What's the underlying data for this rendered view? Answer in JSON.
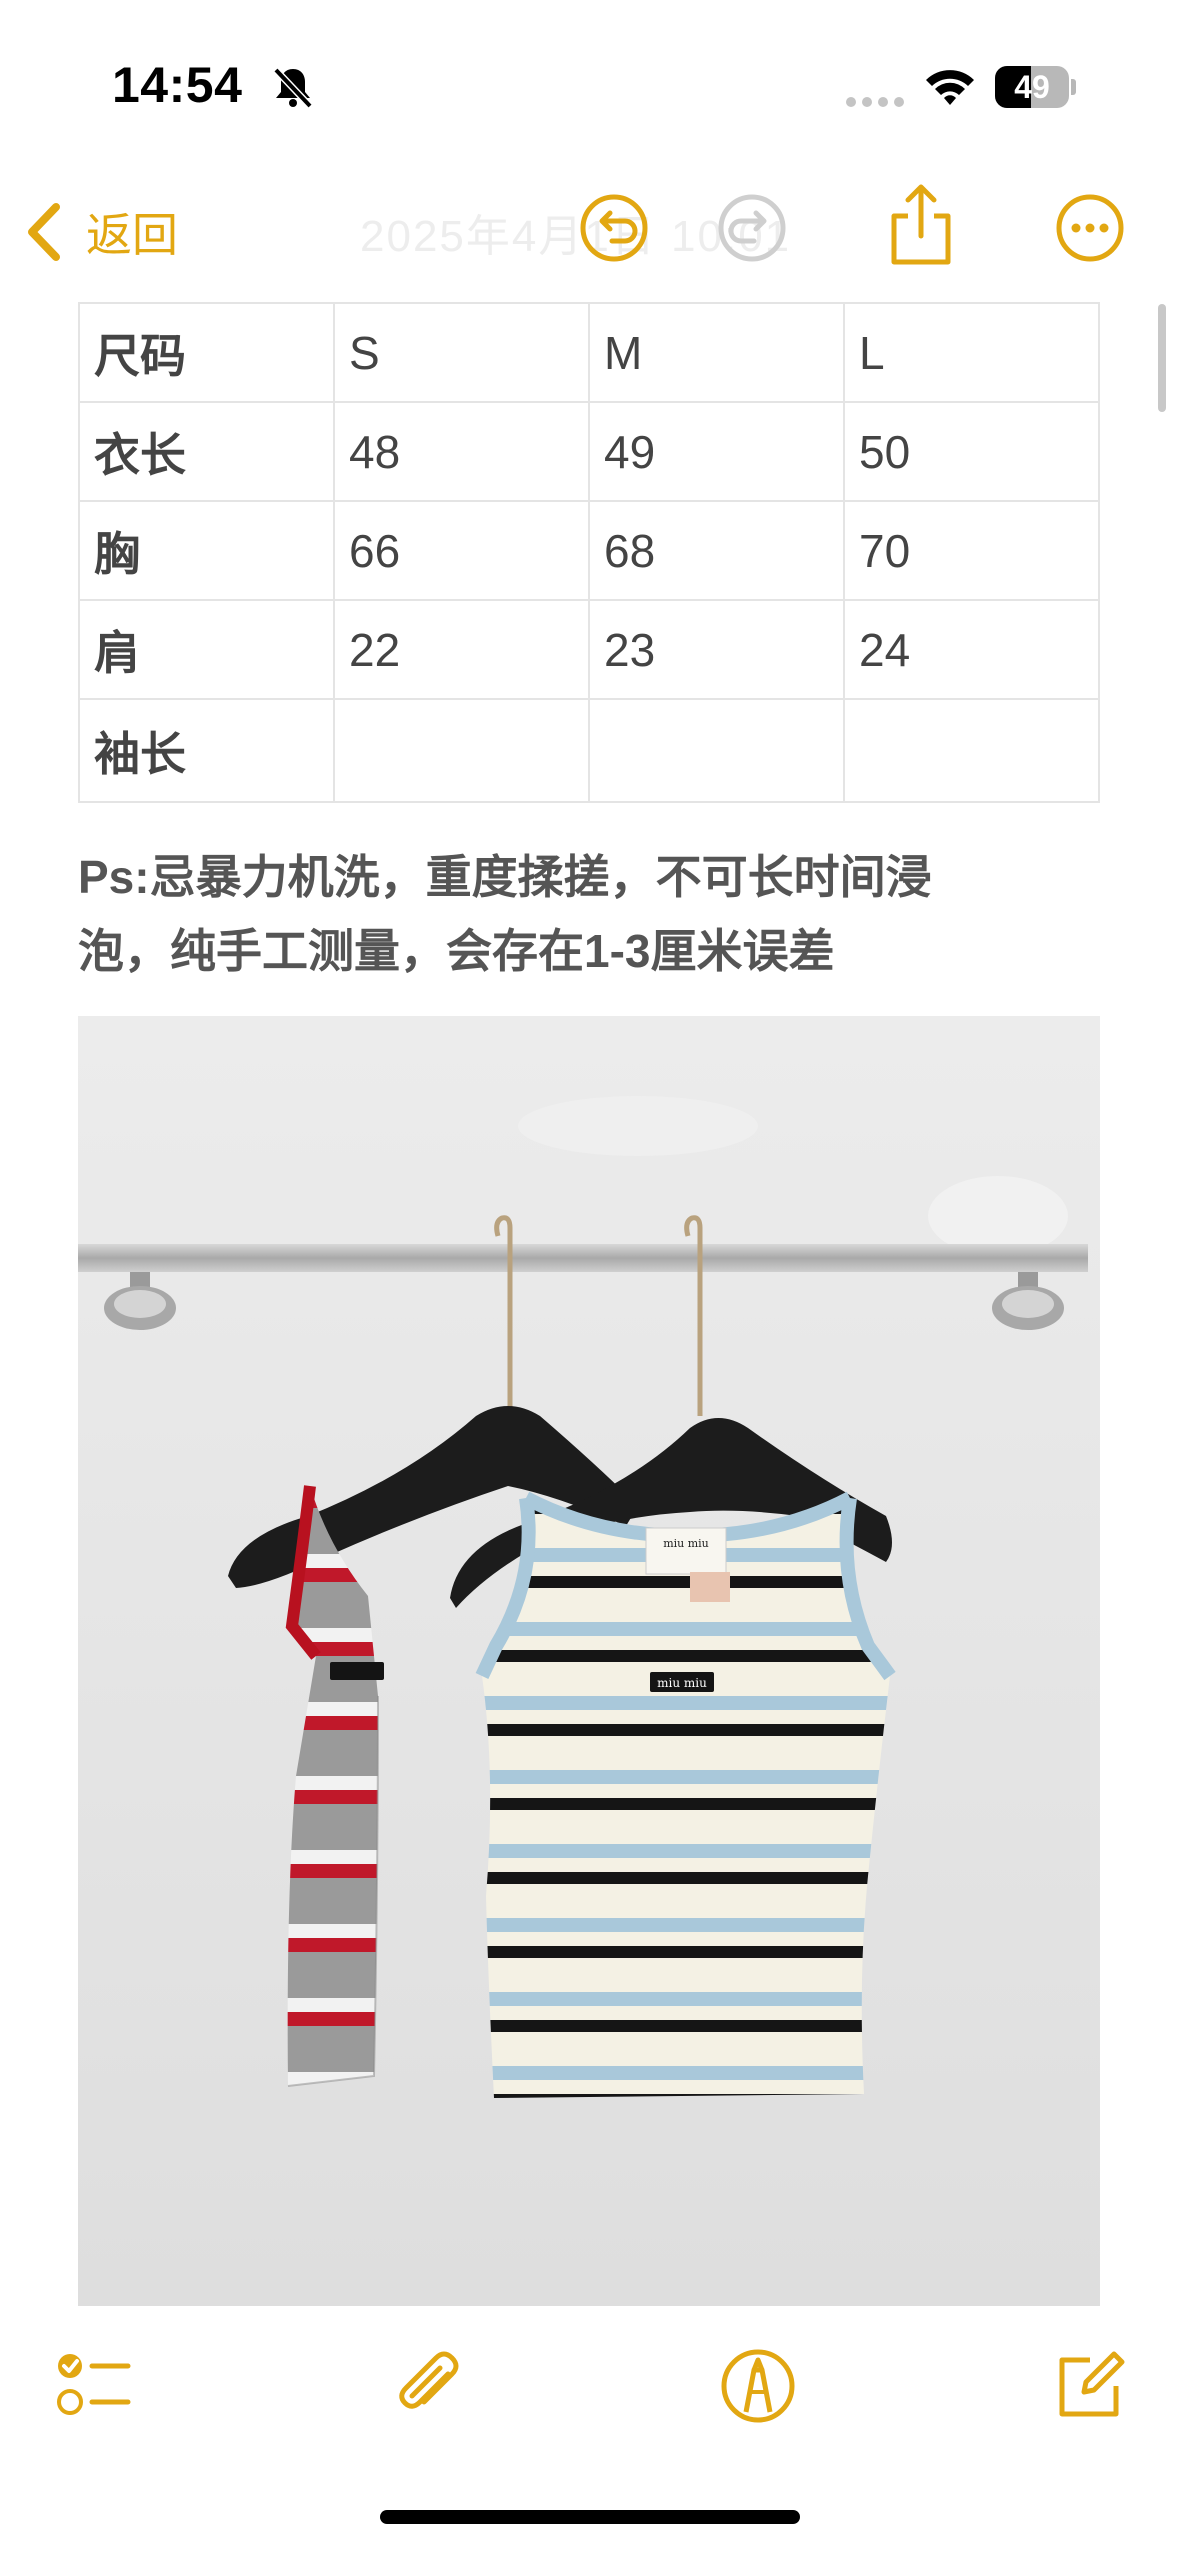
{
  "status_bar": {
    "time": "14:54",
    "battery_level": 49,
    "battery_label": "49",
    "icons": [
      "bell-slash-icon",
      "cellular-dots-icon",
      "wifi-icon",
      "battery-icon"
    ]
  },
  "nav": {
    "back_label": "返回",
    "title": "2025年4月1日 10:01",
    "icons": [
      "chevron-left-icon",
      "undo-icon",
      "redo-icon",
      "share-icon",
      "more-icon"
    ]
  },
  "size_table": {
    "rows": [
      [
        "尺码",
        "S",
        "M",
        "L"
      ],
      [
        "衣长",
        "48",
        "49",
        "50"
      ],
      [
        "胸",
        "66",
        "68",
        "70"
      ],
      [
        "肩",
        "22",
        "23",
        "24"
      ],
      [
        "袖长",
        "",
        "",
        ""
      ]
    ]
  },
  "note": {
    "line1": "Ps:忌暴力机洗，重度揉搓，不可长时间浸",
    "line2": "泡，纯手工测量，会存在1-3厘米误差"
  },
  "photo": {
    "label_text": "miu miu"
  },
  "toolbar": {
    "icons": [
      "checklist-icon",
      "paperclip-icon",
      "markup-pen-icon",
      "compose-icon"
    ]
  },
  "colors": {
    "accent": "#e2a712",
    "text": "#444444",
    "table_border": "#e4e4e4"
  }
}
